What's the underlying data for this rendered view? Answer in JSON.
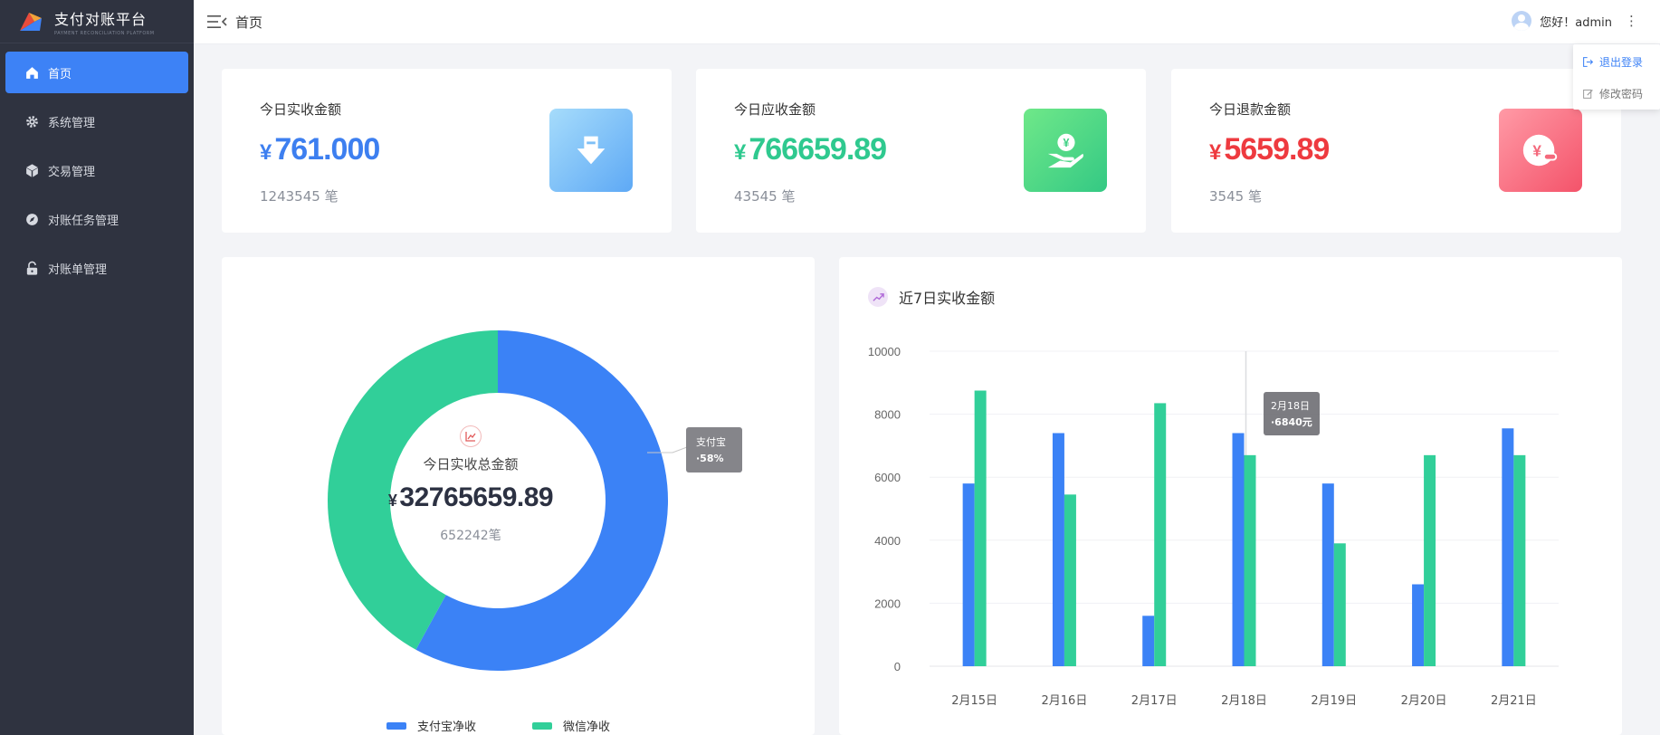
{
  "app": {
    "title": "支付对账平台",
    "subtitle": "PAYMENT RECONCILIATION PLATFORM"
  },
  "sidebar": {
    "items": [
      {
        "label": "首页",
        "icon": "home-icon",
        "active": true
      },
      {
        "label": "系统管理",
        "icon": "gear-icon",
        "active": false
      },
      {
        "label": "交易管理",
        "icon": "cube-icon",
        "active": false
      },
      {
        "label": "对账任务管理",
        "icon": "compass-icon",
        "active": false
      },
      {
        "label": "对账单管理",
        "icon": "lock-icon",
        "active": false
      }
    ]
  },
  "header": {
    "page_title": "首页",
    "greeting": "您好！admin",
    "more": "⋮"
  },
  "user_menu": {
    "items": [
      {
        "label": "退出登录",
        "icon": "logout-icon"
      },
      {
        "label": "修改密码",
        "icon": "edit-icon"
      }
    ]
  },
  "stats": [
    {
      "label": "今日实收金额",
      "currency": "¥",
      "value": "761.000",
      "count": "1243545 笔",
      "color": "#3d7ff0",
      "icon": "download-arrow-icon"
    },
    {
      "label": "今日应收金额",
      "currency": "¥",
      "value": "766659.89",
      "count": "43545 笔",
      "color": "#2fc98f",
      "icon": "hand-coin-icon"
    },
    {
      "label": "今日退款金额",
      "currency": "¥",
      "value": "5659.89",
      "count": "3545 笔",
      "color": "#ee3a3f",
      "icon": "refund-coin-icon"
    }
  ],
  "donut": {
    "center_label": "今日实收总金额",
    "currency": "¥",
    "total": "32765659.89",
    "count": "652242笔",
    "tooltip_name": "支付宝",
    "tooltip_value": "·58%",
    "legend": [
      {
        "name": "支付宝净收",
        "color": "#3b82f6"
      },
      {
        "name": "微信净收",
        "color": "#31cf99"
      }
    ]
  },
  "bar_panel": {
    "title": "近7日实收金额",
    "tooltip_date": "2月18日",
    "tooltip_value": "·6840元"
  },
  "chart_data": [
    {
      "type": "pie",
      "categories": [
        "支付宝净收",
        "微信净收"
      ],
      "values": [
        58,
        42
      ],
      "colors": [
        "#3b82f6",
        "#31cf99"
      ]
    },
    {
      "type": "bar",
      "title": "近7日实收金额",
      "categories": [
        "2月15日",
        "2月16日",
        "2月17日",
        "2月18日",
        "2月19日",
        "2月20日",
        "2月21日"
      ],
      "series": [
        {
          "values": [
            5800,
            7400,
            1600,
            7400,
            5800,
            2600,
            7550
          ],
          "color": "#3b82f6"
        },
        {
          "values": [
            8750,
            5450,
            8350,
            6700,
            3900,
            6700,
            6700
          ],
          "color": "#31cf99"
        }
      ],
      "ylim": [
        0,
        10000
      ],
      "yticks": [
        0,
        2000,
        4000,
        6000,
        8000,
        10000
      ],
      "grid": true
    }
  ]
}
